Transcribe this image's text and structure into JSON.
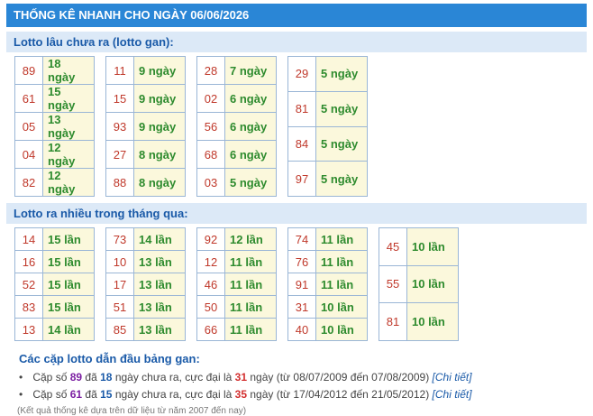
{
  "header": {
    "title": "THỐNG KÊ NHANH CHO NGÀY 06/06/2026"
  },
  "gan": {
    "title": "Lotto lâu chưa ra (lotto gan):",
    "groups": [
      [
        [
          "89",
          "18 ngày"
        ],
        [
          "61",
          "15 ngày"
        ],
        [
          "05",
          "13 ngày"
        ],
        [
          "04",
          "12 ngày"
        ],
        [
          "82",
          "12 ngày"
        ]
      ],
      [
        [
          "11",
          "9 ngày"
        ],
        [
          "15",
          "9 ngày"
        ],
        [
          "93",
          "9 ngày"
        ],
        [
          "27",
          "8 ngày"
        ],
        [
          "88",
          "8 ngày"
        ]
      ],
      [
        [
          "28",
          "7 ngày"
        ],
        [
          "02",
          "6 ngày"
        ],
        [
          "56",
          "6 ngày"
        ],
        [
          "68",
          "6 ngày"
        ],
        [
          "03",
          "5 ngày"
        ]
      ],
      [
        [
          "29",
          "5 ngày"
        ],
        [
          "81",
          "5 ngày"
        ],
        [
          "84",
          "5 ngày"
        ],
        [
          "97",
          "5 ngày"
        ]
      ]
    ]
  },
  "frequent": {
    "title": "Lotto ra nhiều trong tháng qua:",
    "groups": [
      [
        [
          "14",
          "15 lần"
        ],
        [
          "16",
          "15 lần"
        ],
        [
          "52",
          "15 lần"
        ],
        [
          "83",
          "15 lần"
        ],
        [
          "13",
          "14 lần"
        ]
      ],
      [
        [
          "73",
          "14 lần"
        ],
        [
          "10",
          "13 lần"
        ],
        [
          "17",
          "13 lần"
        ],
        [
          "51",
          "13 lần"
        ],
        [
          "85",
          "13 lần"
        ]
      ],
      [
        [
          "92",
          "12 lần"
        ],
        [
          "12",
          "11 lần"
        ],
        [
          "46",
          "11 lần"
        ],
        [
          "50",
          "11 lần"
        ],
        [
          "66",
          "11 lần"
        ]
      ],
      [
        [
          "74",
          "11 lần"
        ],
        [
          "76",
          "11 lần"
        ],
        [
          "91",
          "11 lần"
        ],
        [
          "31",
          "10 lần"
        ],
        [
          "40",
          "10 lần"
        ]
      ],
      [
        [
          "45",
          "10 lần"
        ],
        [
          "55",
          "10 lần"
        ],
        [
          "81",
          "10 lần"
        ]
      ]
    ]
  },
  "pairs": {
    "title": "Các cặp lotto dẫn đầu bảng gan:",
    "items": [
      {
        "prefix": "Cặp số",
        "num": "89",
        "t1": "đã",
        "days": "18",
        "t2": "ngày chưa ra, cực đại là",
        "max": "31",
        "t3": "ngày (từ 08/07/2009 đến 07/08/2009)",
        "link": "[Chi tiết]"
      },
      {
        "prefix": "Cặp số",
        "num": "61",
        "t1": "đã",
        "days": "15",
        "t2": "ngày chưa ra, cực đại là",
        "max": "35",
        "t3": "ngày (từ 17/04/2012 đến 21/05/2012)",
        "link": "[Chi tiết]"
      }
    ]
  },
  "note": "(Kết quả thống kê dựa trên dữ liệu từ năm 2007 đến nay)"
}
